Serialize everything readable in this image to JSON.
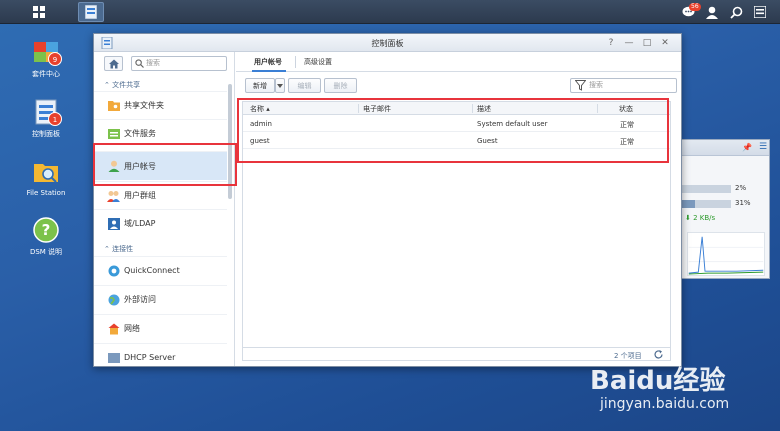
{
  "desktop": {
    "icons": [
      {
        "label": "套件中心",
        "badge": "9"
      },
      {
        "label": "控制面板",
        "badge": "1"
      },
      {
        "label": "File Station"
      },
      {
        "label": "DSM 说明"
      }
    ],
    "notification_count": "56"
  },
  "widget": {
    "cpu_percent": "2%",
    "ram_percent": "31%",
    "cpu_value": 2,
    "ram_value": 31,
    "net_speed": "2 KB/s"
  },
  "window": {
    "title": "控制面板",
    "controls": {
      "help": "?",
      "minimize": "—",
      "maximize": "□",
      "close": "✕"
    }
  },
  "sidebar": {
    "search_placeholder": "搜索",
    "sections": [
      {
        "label": "文件共享"
      },
      {
        "label": "连接性"
      }
    ],
    "items": [
      {
        "label": "共享文件夹"
      },
      {
        "label": "文件服务"
      },
      {
        "label": "用户帐号"
      },
      {
        "label": "用户群组"
      },
      {
        "label": "域/LDAP"
      },
      {
        "label": "QuickConnect"
      },
      {
        "label": "外部访问"
      },
      {
        "label": "网络"
      },
      {
        "label": "DHCP Server"
      }
    ]
  },
  "main": {
    "tabs": [
      {
        "label": "用户帐号"
      },
      {
        "label": "高级设置"
      }
    ],
    "toolbar": {
      "new_label": "新增",
      "edit_label": "编辑",
      "delete_label": "删除",
      "filter_placeholder": "搜索"
    },
    "columns": [
      "名称 ▴",
      "电子邮件",
      "描述",
      "状态"
    ],
    "rows": [
      {
        "name": "admin",
        "email": "",
        "description": "System default user",
        "status": "正常"
      },
      {
        "name": "guest",
        "email": "",
        "description": "Guest",
        "status": "正常"
      }
    ],
    "item_count": "2 个项目"
  },
  "watermark": {
    "logo": "Baidu经验",
    "url": "jingyan.baidu.com"
  },
  "colors": {
    "accent": "#3a7fd5",
    "highlight": "#e8343c",
    "active_item": "#d8e7f7",
    "desktop": "#2a5fa8"
  }
}
